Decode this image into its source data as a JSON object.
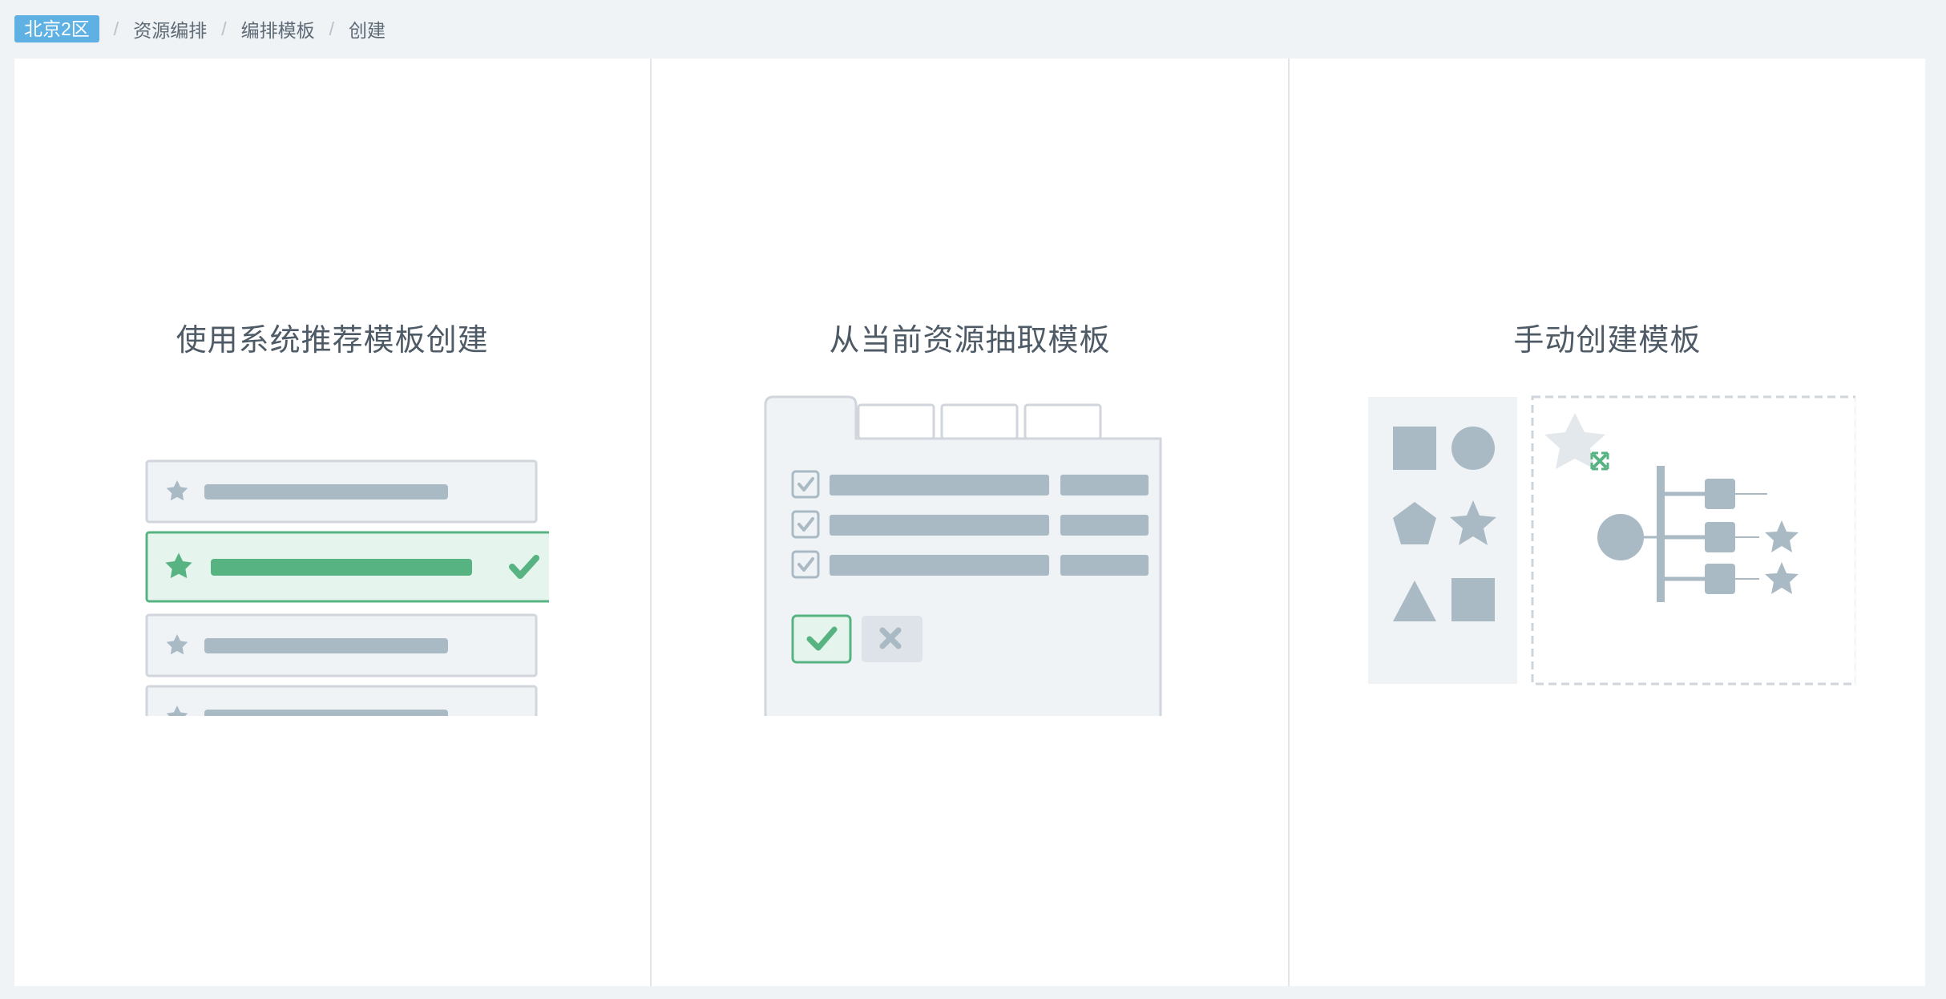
{
  "breadcrumb": {
    "region": "北京2区",
    "items": [
      "资源编排",
      "编排模板",
      "创建"
    ],
    "separator": "/"
  },
  "cards": [
    {
      "title": "使用系统推荐模板创建",
      "illustration": "recommended-template-list"
    },
    {
      "title": "从当前资源抽取模板",
      "illustration": "extract-from-resources-form"
    },
    {
      "title": "手动创建模板",
      "illustration": "manual-canvas-designer"
    }
  ],
  "colors": {
    "accent_blue": "#5fb1e4",
    "accent_green": "#58b383",
    "shape_gray": "#a9bac5",
    "panel_bg": "#eff3f6",
    "border_gray": "#d0d6dc"
  }
}
